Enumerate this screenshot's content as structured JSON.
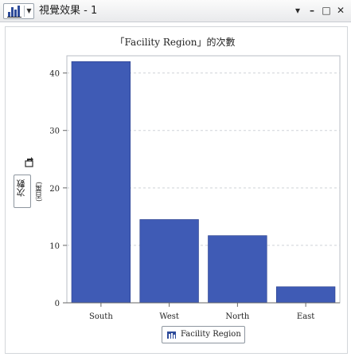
{
  "window": {
    "title": "視覺效果 - 1",
    "controls": {
      "options": "▾",
      "minimize": "–",
      "maximize": "□",
      "close": "✕"
    }
  },
  "chart_data": {
    "type": "bar",
    "title": "「Facility Region」的次數",
    "categories": [
      "South",
      "West",
      "North",
      "East"
    ],
    "values": [
      42,
      14.5,
      11.7,
      2.8
    ],
    "ylim": [
      0,
      43
    ],
    "yticks": [
      0,
      10,
      20,
      30,
      40
    ],
    "ylabel": "次數",
    "ylabel_extra": "(百萬)",
    "grid": true,
    "legend": {
      "label": "Facility Region",
      "placement": "bottom"
    },
    "bar_color": "#3f5bb5"
  }
}
